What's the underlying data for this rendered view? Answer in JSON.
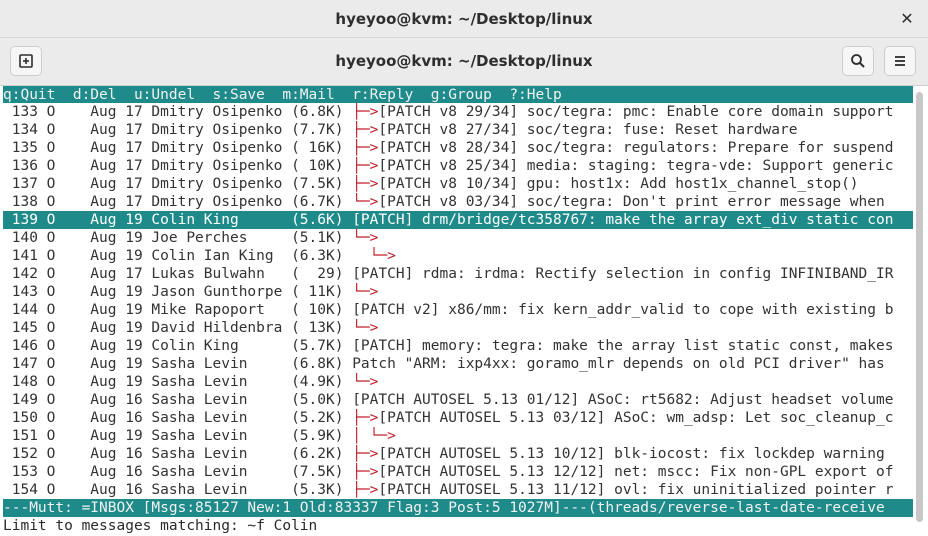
{
  "window": {
    "title": "hyeyoo@kvm: ~/Desktop/linux"
  },
  "header": {
    "title": "hyeyoo@kvm: ~/Desktop/linux"
  },
  "menu_bar": "q:Quit  d:Del  u:Undel  s:Save  m:Mail  r:Reply  g:Group  ?:Help",
  "rows": [
    {
      "num": " 133",
      "flag": "O",
      "date": "Aug 17",
      "from": "Dmitry Osipenko",
      "size": "(6.8K)",
      "tree": "├─>",
      "subject": "[PATCH v8 29/34] soc/tegra: pmc: Enable core domain support"
    },
    {
      "num": " 134",
      "flag": "O",
      "date": "Aug 17",
      "from": "Dmitry Osipenko",
      "size": "(7.7K)",
      "tree": "├─>",
      "subject": "[PATCH v8 27/34] soc/tegra: fuse: Reset hardware"
    },
    {
      "num": " 135",
      "flag": "O",
      "date": "Aug 17",
      "from": "Dmitry Osipenko",
      "size": "( 16K)",
      "tree": "├─>",
      "subject": "[PATCH v8 28/34] soc/tegra: regulators: Prepare for suspend"
    },
    {
      "num": " 136",
      "flag": "O",
      "date": "Aug 17",
      "from": "Dmitry Osipenko",
      "size": "( 10K)",
      "tree": "├─>",
      "subject": "[PATCH v8 25/34] media: staging: tegra-vde: Support generic"
    },
    {
      "num": " 137",
      "flag": "O",
      "date": "Aug 17",
      "from": "Dmitry Osipenko",
      "size": "(7.5K)",
      "tree": "├─>",
      "subject": "[PATCH v8 10/34] gpu: host1x: Add host1x_channel_stop()"
    },
    {
      "num": " 138",
      "flag": "O",
      "date": "Aug 17",
      "from": "Dmitry Osipenko",
      "size": "(6.7K)",
      "tree": "└─>",
      "subject": "[PATCH v8 03/34] soc/tegra: Don't print error message when"
    },
    {
      "num": " 139",
      "flag": "O",
      "date": "Aug 19",
      "from": "Colin King     ",
      "size": "(5.6K)",
      "tree": "",
      "subject": "[PATCH] drm/bridge/tc358767: make the array ext_div static con"
    },
    {
      "num": " 140",
      "flag": "O",
      "date": "Aug 19",
      "from": "Joe Perches    ",
      "size": "(5.1K)",
      "tree": "└─>",
      "subject": ""
    },
    {
      "num": " 141",
      "flag": "O",
      "date": "Aug 19",
      "from": "Colin Ian King ",
      "size": "(6.3K)",
      "tree": "  └─>",
      "subject": ""
    },
    {
      "num": " 142",
      "flag": "O",
      "date": "Aug 17",
      "from": "Lukas Bulwahn  ",
      "size": "(  29)",
      "tree": "",
      "subject": "[PATCH] rdma: irdma: Rectify selection in config INFINIBAND_IR"
    },
    {
      "num": " 143",
      "flag": "O",
      "date": "Aug 19",
      "from": "Jason Gunthorpe",
      "size": "( 11K)",
      "tree": "└─>",
      "subject": ""
    },
    {
      "num": " 144",
      "flag": "O",
      "date": "Aug 19",
      "from": "Mike Rapoport  ",
      "size": "( 10K)",
      "tree": "",
      "subject": "[PATCH v2] x86/mm: fix kern_addr_valid to cope with existing b"
    },
    {
      "num": " 145",
      "flag": "O",
      "date": "Aug 19",
      "from": "David Hildenbra",
      "size": "( 13K)",
      "tree": "└─>",
      "subject": ""
    },
    {
      "num": " 146",
      "flag": "O",
      "date": "Aug 19",
      "from": "Colin King     ",
      "size": "(5.7K)",
      "tree": "",
      "subject": "[PATCH] memory: tegra: make the array list static const, makes"
    },
    {
      "num": " 147",
      "flag": "O",
      "date": "Aug 19",
      "from": "Sasha Levin    ",
      "size": "(6.8K)",
      "tree": "",
      "subject": "Patch \"ARM: ixp4xx: goramo_mlr depends on old PCI driver\" has"
    },
    {
      "num": " 148",
      "flag": "O",
      "date": "Aug 19",
      "from": "Sasha Levin    ",
      "size": "(4.9K)",
      "tree": "└─>",
      "subject": ""
    },
    {
      "num": " 149",
      "flag": "O",
      "date": "Aug 16",
      "from": "Sasha Levin    ",
      "size": "(5.0K)",
      "tree": "",
      "subject": "[PATCH AUTOSEL 5.13 01/12] ASoC: rt5682: Adjust headset volume"
    },
    {
      "num": " 150",
      "flag": "O",
      "date": "Aug 16",
      "from": "Sasha Levin    ",
      "size": "(5.2K)",
      "tree": "├─>",
      "subject": "[PATCH AUTOSEL 5.13 03/12] ASoC: wm_adsp: Let soc_cleanup_c"
    },
    {
      "num": " 151",
      "flag": "O",
      "date": "Aug 19",
      "from": "Sasha Levin    ",
      "size": "(5.9K)",
      "tree": "│ └─>",
      "subject": ""
    },
    {
      "num": " 152",
      "flag": "O",
      "date": "Aug 16",
      "from": "Sasha Levin    ",
      "size": "(6.2K)",
      "tree": "├─>",
      "subject": "[PATCH AUTOSEL 5.13 10/12] blk-iocost: fix lockdep warning"
    },
    {
      "num": " 153",
      "flag": "O",
      "date": "Aug 16",
      "from": "Sasha Levin    ",
      "size": "(7.5K)",
      "tree": "├─>",
      "subject": "[PATCH AUTOSEL 5.13 12/12] net: mscc: Fix non-GPL export of"
    },
    {
      "num": " 154",
      "flag": "O",
      "date": "Aug 16",
      "from": "Sasha Levin    ",
      "size": "(5.3K)",
      "tree": "├─>",
      "subject": "[PATCH AUTOSEL 5.13 11/12] ovl: fix uninitialized pointer r"
    }
  ],
  "selected_index": 6,
  "status_bar": "---Mutt: =INBOX [Msgs:85127 New:1 Old:83337 Flag:3 Post:5 1027M]---(threads/reverse-last-date-receive",
  "prompt": "Limit to messages matching: ~f Colin"
}
